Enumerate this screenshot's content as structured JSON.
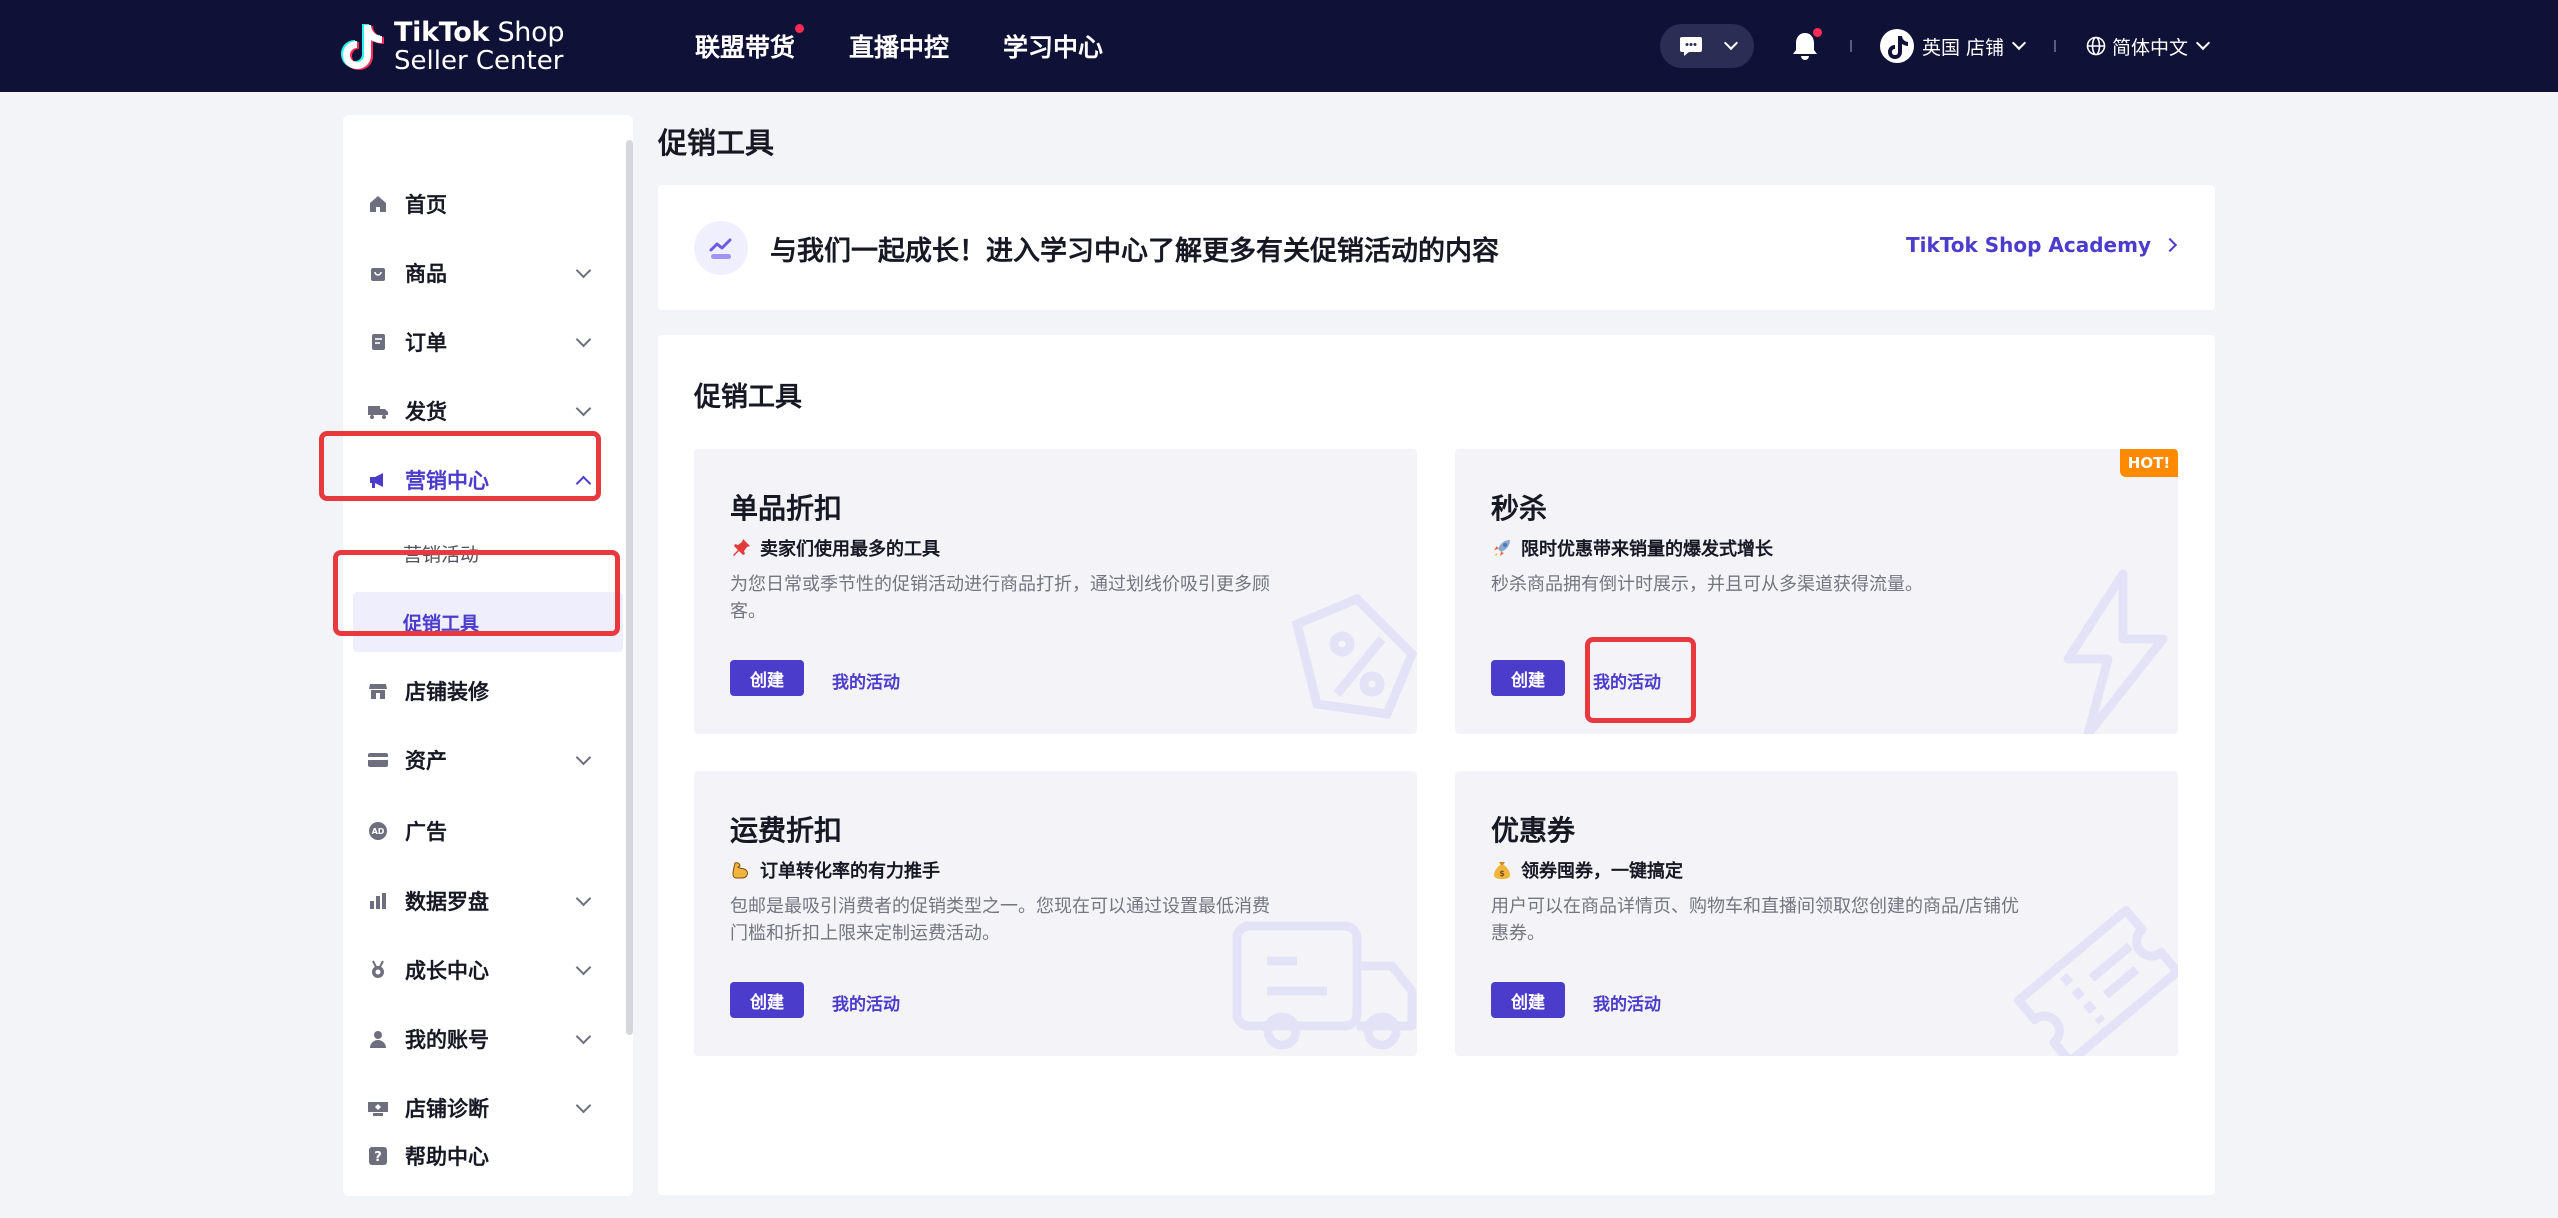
{
  "header": {
    "logo_line1_bold": "TikTok",
    "logo_line1_light": " Shop",
    "logo_line2": "Seller Center",
    "nav": [
      "联盟带货",
      "直播中控",
      "学习中心"
    ],
    "store_label": "英国 店铺",
    "lang_label": "简体中文"
  },
  "sidebar": {
    "items": [
      {
        "label": "首页"
      },
      {
        "label": "商品"
      },
      {
        "label": "订单"
      },
      {
        "label": "发货"
      },
      {
        "label": "营销中心"
      },
      {
        "label": "店铺装修"
      },
      {
        "label": "资产"
      },
      {
        "label": "广告"
      },
      {
        "label": "数据罗盘"
      },
      {
        "label": "成长中心"
      },
      {
        "label": "我的账号"
      },
      {
        "label": "店铺诊断"
      },
      {
        "label": "帮助中心"
      }
    ],
    "sub_items": [
      {
        "label": "营销活动"
      },
      {
        "label": "促销工具"
      }
    ]
  },
  "main": {
    "page_title": "促销工具",
    "banner": {
      "text": "与我们一起成长！进入学习中心了解更多有关促销活动的内容",
      "link": "TikTok Shop Academy"
    },
    "panel_title": "促销工具",
    "cards": [
      {
        "title": "单品折扣",
        "subtitle": "卖家们使用最多的工具",
        "desc": "为您日常或季节性的促销活动进行商品打折，通过划线价吸引更多顾客。",
        "create": "创建",
        "my_activity": "我的活动"
      },
      {
        "title": "秒杀",
        "badge": "HOT!",
        "subtitle": "限时优惠带来销量的爆发式增长",
        "desc": "秒杀商品拥有倒计时展示，并且可从多渠道获得流量。",
        "create": "创建",
        "my_activity": "我的活动"
      },
      {
        "title": "运费折扣",
        "subtitle": "订单转化率的有力推手",
        "desc": "包邮是最吸引消费者的促销类型之一。您现在可以通过设置最低消费门槛和折扣上限来定制运费活动。",
        "create": "创建",
        "my_activity": "我的活动"
      },
      {
        "title": "优惠券",
        "subtitle": "领券囤券，一键搞定",
        "desc": "用户可以在商品详情页、购物车和直播间领取您创建的商品/店铺优惠券。",
        "create": "创建",
        "my_activity": "我的活动"
      }
    ]
  },
  "colors": {
    "topbar": "#0f1136",
    "accent": "#4b3ccc",
    "highlight": "#e8393f",
    "hot": "#ff8a00"
  }
}
